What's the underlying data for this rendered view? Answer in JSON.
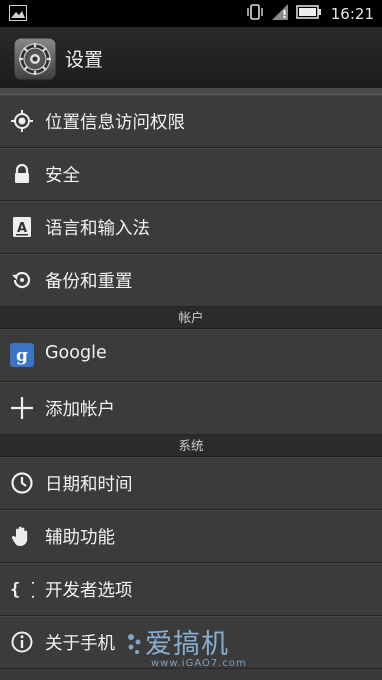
{
  "status_bar": {
    "time": "16:21",
    "icons": [
      "image-notification-icon",
      "vibrate-icon",
      "no-signal-icon",
      "battery-icon"
    ]
  },
  "header": {
    "title": "设置",
    "icon": "settings-gear-icon"
  },
  "settings": {
    "personal": [
      {
        "label": "位置信息访问权限",
        "icon": "location-icon"
      },
      {
        "label": "安全",
        "icon": "lock-icon"
      },
      {
        "label": "语言和输入法",
        "icon": "keyboard-a-icon"
      },
      {
        "label": "备份和重置",
        "icon": "restore-icon"
      }
    ],
    "accounts_header": "帐户",
    "accounts": [
      {
        "label": "Google",
        "icon": "google-icon"
      },
      {
        "label": "添加帐户",
        "icon": "plus-icon"
      }
    ],
    "system_header": "系统",
    "system": [
      {
        "label": "日期和时间",
        "icon": "clock-icon"
      },
      {
        "label": "辅助功能",
        "icon": "hand-icon"
      },
      {
        "label": "开发者选项",
        "icon": "braces-icon"
      },
      {
        "label": "关于手机",
        "icon": "info-icon"
      }
    ]
  },
  "watermark": {
    "text": "爱搞机",
    "url": "www.iGAO7.com"
  }
}
